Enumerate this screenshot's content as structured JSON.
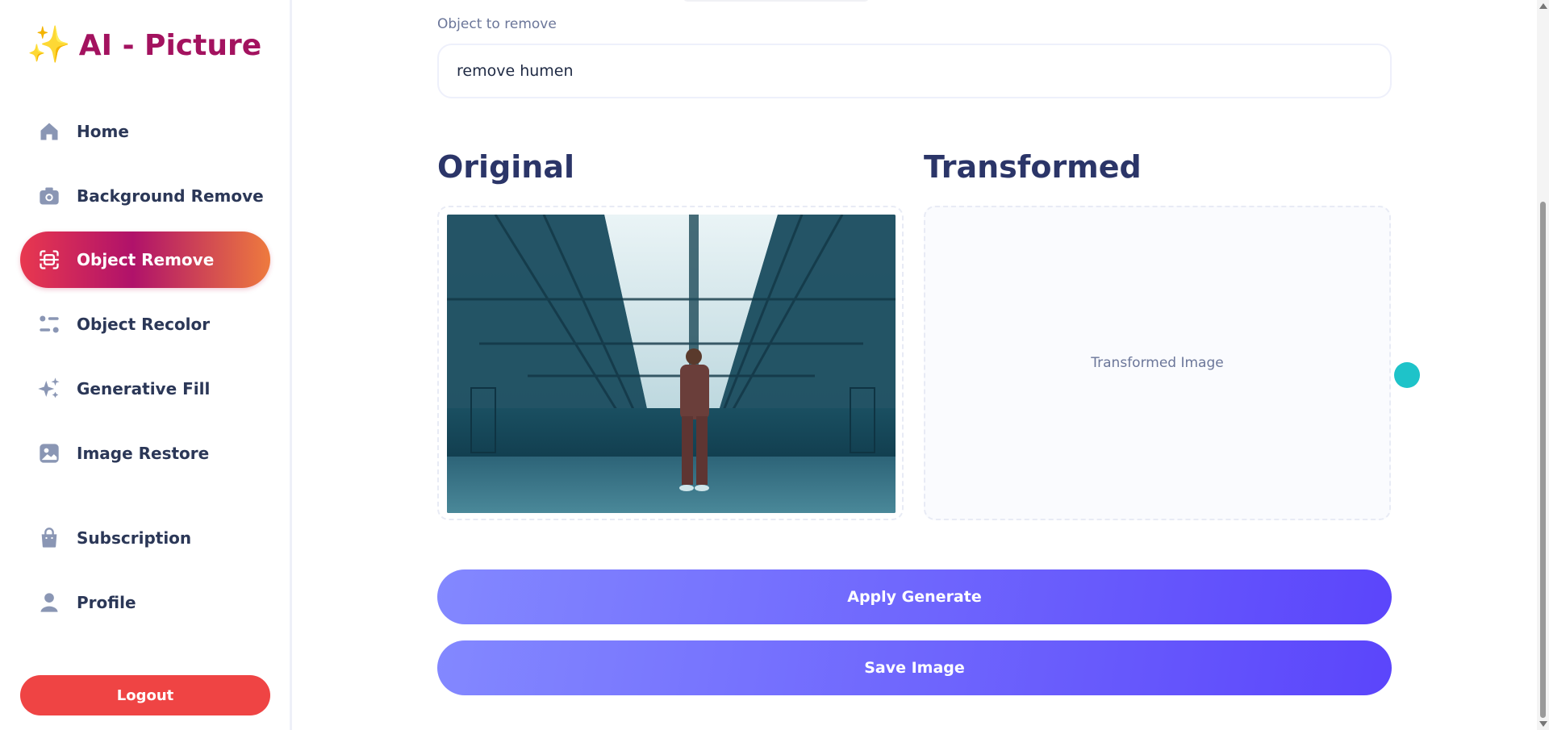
{
  "app": {
    "logo_text": "AI - Picture",
    "logo_emoji": "✨"
  },
  "sidebar": {
    "items": [
      {
        "label": "Home",
        "icon": "home-icon"
      },
      {
        "label": "Background Remove",
        "icon": "camera-icon"
      },
      {
        "label": "Object Remove",
        "icon": "scan-icon",
        "active": true
      },
      {
        "label": "Object Recolor",
        "icon": "filter-icon"
      },
      {
        "label": "Generative Fill",
        "icon": "sparkles-icon"
      },
      {
        "label": "Image Restore",
        "icon": "image-icon"
      },
      {
        "label": "Subscription",
        "icon": "bag-icon"
      },
      {
        "label": "Profile",
        "icon": "user-icon"
      }
    ],
    "logout_label": "Logout"
  },
  "form": {
    "field_label": "Object to remove",
    "field_value": "remove humen"
  },
  "panels": {
    "original_title": "Original",
    "transformed_title": "Transformed",
    "transformed_placeholder": "Transformed Image"
  },
  "actions": {
    "apply_label": "Apply Generate",
    "save_label": "Save Image"
  },
  "colors": {
    "brand": "#a3125f",
    "accent_gradient_start": "#8388ff",
    "accent_gradient_end": "#5b45fb",
    "logout": "#ef4444",
    "active_gradient": [
      "#e8384f",
      "#b0126a",
      "#ee7a3e"
    ]
  }
}
